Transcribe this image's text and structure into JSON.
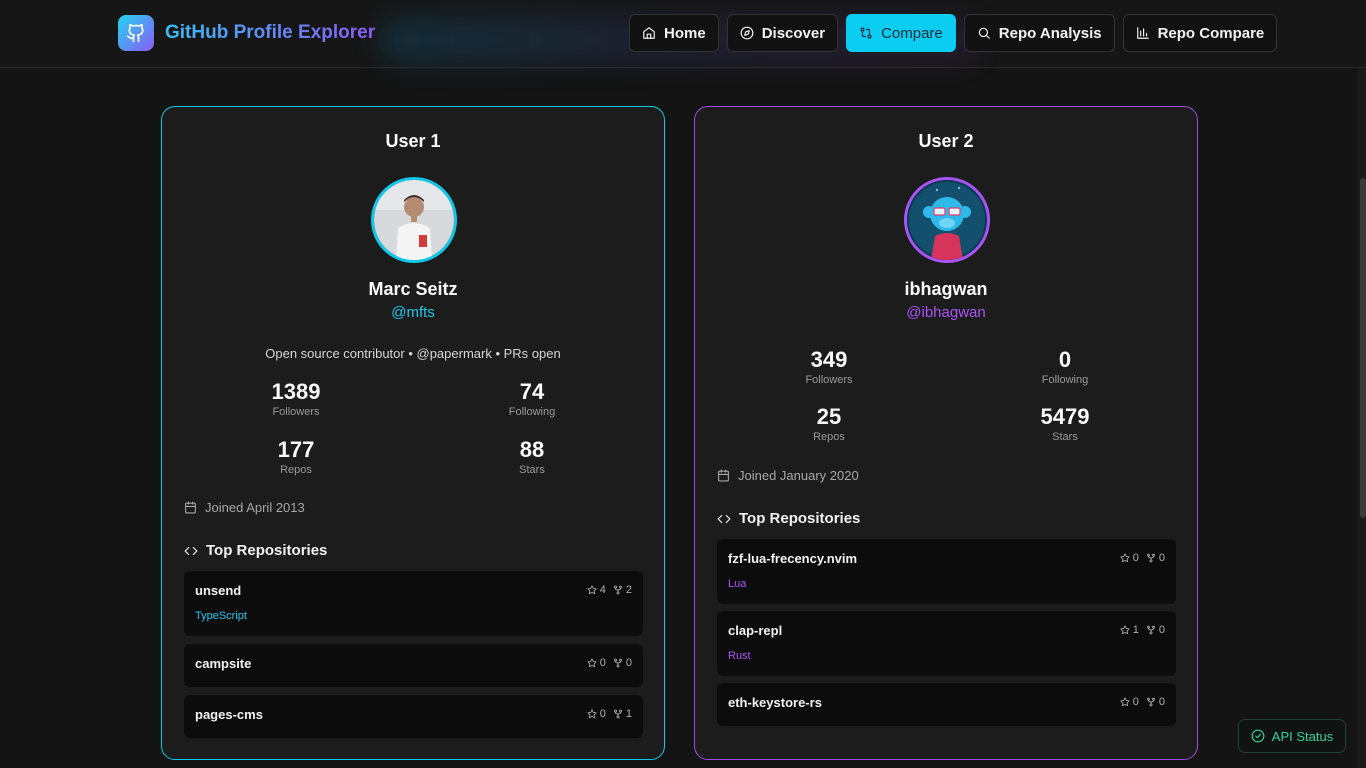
{
  "brand": {
    "title": "GitHub Profile Explorer",
    "logo_icon": "github-icon"
  },
  "nav": {
    "home": "Home",
    "discover": "Discover",
    "compare": "Compare",
    "repo_analysis": "Repo Analysis",
    "repo_compare": "Repo Compare"
  },
  "colors": {
    "accent_cyan": "#0bcdf2",
    "accent_purple": "#a855f7",
    "typescript": "#22c9ee",
    "lua": "#a855f7",
    "rust": "#a855f7",
    "status_green": "#34d399"
  },
  "user1": {
    "title": "User 1",
    "name": "Marc Seitz",
    "handle": "@mfts",
    "bio": "Open source contributor • @papermark • PRs open",
    "followers": "1389",
    "followers_label": "Followers",
    "following": "74",
    "following_label": "Following",
    "repos": "177",
    "repos_label": "Repos",
    "stars": "88",
    "stars_label": "Stars",
    "joined": "Joined April 2013",
    "top_repos_label": "Top Repositories",
    "repos_list": [
      {
        "name": "unsend",
        "stars": "4",
        "forks": "2",
        "language": "TypeScript"
      },
      {
        "name": "campsite",
        "stars": "0",
        "forks": "0"
      },
      {
        "name": "pages-cms",
        "stars": "0",
        "forks": "1"
      }
    ]
  },
  "user2": {
    "title": "User 2",
    "name": "ibhagwan",
    "handle": "@ibhagwan",
    "followers": "349",
    "followers_label": "Followers",
    "following": "0",
    "following_label": "Following",
    "repos": "25",
    "repos_label": "Repos",
    "stars": "5479",
    "stars_label": "Stars",
    "joined": "Joined January 2020",
    "top_repos_label": "Top Repositories",
    "repos_list": [
      {
        "name": "fzf-lua-frecency.nvim",
        "stars": "0",
        "forks": "0",
        "language": "Lua"
      },
      {
        "name": "clap-repl",
        "stars": "1",
        "forks": "0",
        "language": "Rust"
      },
      {
        "name": "eth-keystore-rs",
        "stars": "0",
        "forks": "0"
      }
    ]
  },
  "api_status": "API Status"
}
